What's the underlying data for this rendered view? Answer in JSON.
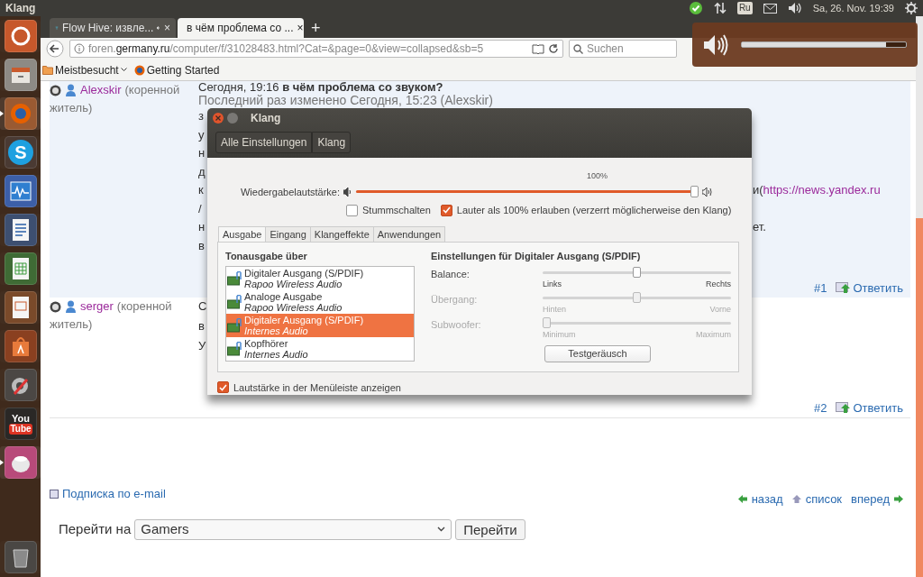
{
  "top_panel": {
    "title": "Klang",
    "indicators": [
      {
        "kind": "check"
      },
      {
        "kind": "network"
      },
      {
        "kind": "keyboard",
        "text": "Ru"
      },
      {
        "kind": "mail"
      },
      {
        "kind": "sound"
      }
    ],
    "clock": "Sa, 26. Nov. 19:39"
  },
  "launcher": [
    {
      "kind": "ubuntu",
      "running": false
    },
    {
      "kind": "files",
      "running": false
    },
    {
      "kind": "firefox",
      "running": true
    },
    {
      "kind": "skype",
      "text": "S",
      "running": false
    },
    {
      "kind": "monitor",
      "running": false
    },
    {
      "kind": "writer",
      "running": false
    },
    {
      "kind": "calc",
      "running": false
    },
    {
      "kind": "impress",
      "running": false
    },
    {
      "kind": "store",
      "running": false
    },
    {
      "kind": "settings",
      "running": false
    },
    {
      "kind": "youtube",
      "text": "You",
      "text2": "Tube",
      "running": false
    },
    {
      "kind": "app",
      "running": true
    },
    {
      "kind": "trash",
      "running": false
    }
  ],
  "browser": {
    "tabs": [
      {
        "title": "Flow Hive: извле...",
        "audio": true,
        "selected": false,
        "close": "×"
      },
      {
        "title": "в чём проблема со ...",
        "audio": false,
        "selected": true,
        "close": "×"
      }
    ],
    "new_tab": "+",
    "url": {
      "prefix": "foren.",
      "domain": "germany.ru",
      "rest": "/computer/f/31028483.html?Cat=&page=0&view=collapsed&sb=5"
    },
    "search": {
      "placeholder": "Suchen"
    },
    "bookmarks": [
      {
        "kind": "folder",
        "label": "Meistbesucht"
      },
      {
        "kind": "firefox",
        "label": "Getting Started"
      }
    ]
  },
  "posts": [
    {
      "author": "Alexskir",
      "rank": "(коренной",
      "rank2": "житель)",
      "header": "Сегодня, 19:16 **в чём проблема со звуком?**",
      "edited": "Последний раз изменено Сегодня, 15:23 (Alexskir)",
      "lines": [
        {
          "left": "з"
        },
        {
          "left": "у"
        },
        {
          "left": "н"
        },
        {
          "left": "д"
        },
        {
          "left": "к",
          "right": "и(",
          "link": "https://news.yandex.ru"
        },
        {
          "left": "/"
        },
        {
          "left": "н",
          "right": "ет."
        },
        {
          "left": "в"
        }
      ],
      "number": "#1",
      "reply": "Ответить"
    },
    {
      "author": "serger",
      "rank": "(коренной",
      "rank2": "житель)",
      "lines": [
        {
          "left": "С"
        },
        {
          "left": "в"
        },
        {
          "left": "У"
        }
      ],
      "number": "#2",
      "reply": "Ответить"
    }
  ],
  "subscribe": "Подписка по e-mail",
  "nav": {
    "back": "назад",
    "list": "список",
    "forward": "вперед"
  },
  "jump": {
    "label": "Перейти на",
    "value": "Gamers",
    "button": "Перейти"
  },
  "volume_popup": {
    "level": 0.88
  },
  "dialog": {
    "title": "Klang",
    "breadcrumbs": [
      "Alle Einstellungen",
      "Klang"
    ],
    "volume": {
      "label": "Wiedergabelautstärke:",
      "mark": "100%",
      "level": 1.0
    },
    "mute": {
      "label": "Stummschalten",
      "checked": false
    },
    "overamp": {
      "label": "Lauter als 100% erlauben (verzerrt möglicherweise den Klang)",
      "checked": true
    },
    "tabs": [
      {
        "label": "Ausgabe",
        "selected": true
      },
      {
        "label": "Eingang",
        "selected": false
      },
      {
        "label": "Klangeffekte",
        "selected": false
      },
      {
        "label": "Anwendungen",
        "selected": false
      }
    ],
    "devices_heading": "Tonausgabe über",
    "devices": [
      {
        "name": "Digitaler Ausgang (S/PDIF)",
        "card": "Rapoo Wireless Audio",
        "selected": false
      },
      {
        "name": "Analoge Ausgabe",
        "card": "Rapoo Wireless Audio",
        "selected": false
      },
      {
        "name": "Digitaler Ausgang (S/PDIF)",
        "card": "Internes Audio",
        "selected": true
      },
      {
        "name": "Kopfhörer",
        "card": "Internes Audio",
        "selected": false
      }
    ],
    "settings_heading": "Einstellungen für Digitaler Ausgang (S/PDIF)",
    "sliders": [
      {
        "label": "Balance:",
        "min": "Links",
        "max": "Rechts",
        "level": 0.5,
        "disabled": false
      },
      {
        "label": "Übergang:",
        "min": "Hinten",
        "max": "Vorne",
        "level": 0.5,
        "disabled": true
      },
      {
        "label": "Subwoofer:",
        "min": "Minimum",
        "max": "Maximum",
        "level": 0.0,
        "disabled": true
      }
    ],
    "test_button": "Testgeräusch",
    "show_in_menu": {
      "label": "Lautstärke in der Menüleiste anzeigen",
      "checked": true
    }
  }
}
